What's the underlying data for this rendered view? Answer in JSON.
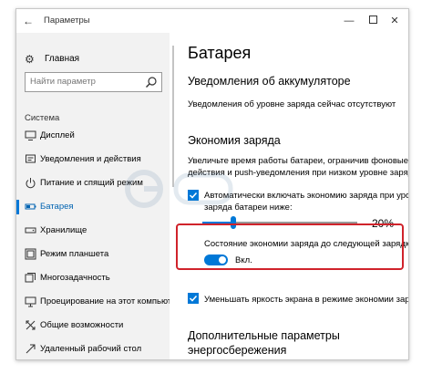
{
  "window": {
    "title": "Параметры",
    "back_glyph": "←",
    "min_glyph": "—",
    "close_glyph": "✕"
  },
  "sidebar": {
    "home_label": "Главная",
    "search_placeholder": "Найти параметр",
    "section_label": "Система",
    "items": [
      {
        "label": "Дисплей",
        "icon": "display-icon"
      },
      {
        "label": "Уведомления и действия",
        "icon": "notifications-icon"
      },
      {
        "label": "Питание и спящий режим",
        "icon": "power-icon"
      },
      {
        "label": "Батарея",
        "icon": "battery-icon",
        "active": true
      },
      {
        "label": "Хранилище",
        "icon": "storage-icon"
      },
      {
        "label": "Режим планшета",
        "icon": "tablet-mode-icon"
      },
      {
        "label": "Многозадачность",
        "icon": "multitasking-icon"
      },
      {
        "label": "Проецирование на этот компьютер",
        "icon": "projecting-icon"
      },
      {
        "label": "Общие возможности",
        "icon": "shared-experiences-icon"
      },
      {
        "label": "Удаленный рабочий стол",
        "icon": "remote-desktop-icon"
      }
    ]
  },
  "main": {
    "page_title": "Батарея",
    "notifications_heading": "Уведомления об аккумуляторе",
    "notifications_text": "Уведомления об уровне заряда сейчас отсутствуют",
    "saver_heading": "Экономия заряда",
    "saver_desc_line1": "Увеличьте время работы батареи, ограничив фоновые",
    "saver_desc_line2": "действия и push-уведомления при низком уровне заряда.",
    "auto_checkbox_line1": "Автоматически включать экономию заряда при уровне",
    "auto_checkbox_line2": "заряда батареи ниже:",
    "auto_checkbox_checked": true,
    "slider_value": 0.2,
    "slider_label": "20%",
    "status_label": "Состояние экономии заряда до следующей зарядки",
    "toggle_on": true,
    "toggle_label": "Вкл.",
    "brightness_checkbox_label": "Уменьшать яркость экрана в режиме экономии заряда",
    "brightness_checkbox_checked": true,
    "more_heading_line1": "Дополнительные параметры",
    "more_heading_line2": "энергосбережения"
  },
  "colors": {
    "accent": "#0078d7",
    "active_text": "#0063b1",
    "highlight_border": "#d0232b",
    "sidebar_bg": "#f2f2f2"
  }
}
